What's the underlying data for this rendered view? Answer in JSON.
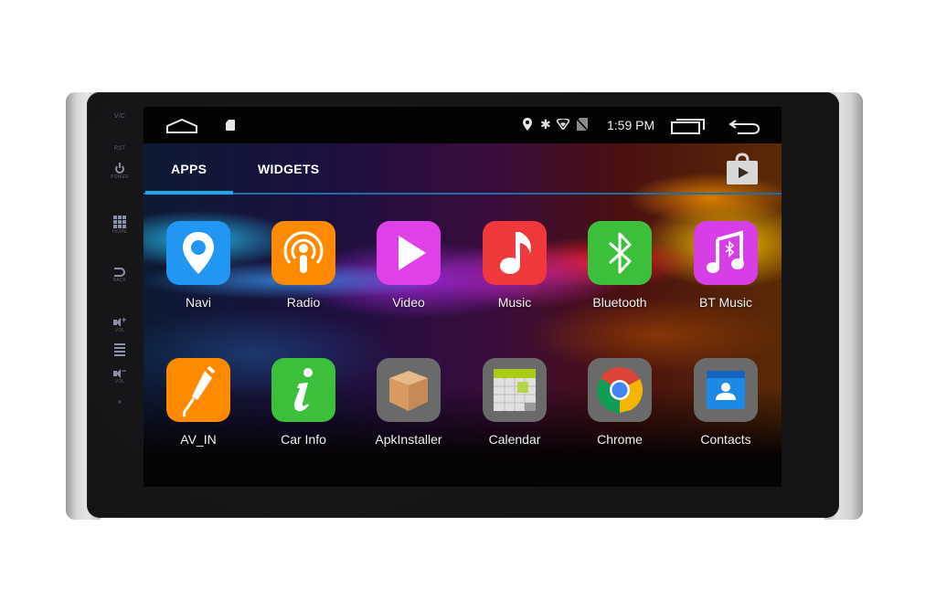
{
  "device": {
    "hardkeys": [
      {
        "id": "vc",
        "label": "V/C"
      },
      {
        "id": "rst",
        "label": "RST"
      },
      {
        "id": "power",
        "label": "POWER"
      },
      {
        "id": "home",
        "label": "HOME"
      },
      {
        "id": "back",
        "label": "BACK"
      },
      {
        "id": "volup",
        "label": "VOL"
      },
      {
        "id": "voldown",
        "label": "VOL"
      }
    ]
  },
  "statusbar": {
    "time": "1:59 PM",
    "icons": [
      "home-icon",
      "sd-card-icon",
      "location-icon",
      "bluetooth-icon",
      "wifi-icon",
      "no-sim-icon",
      "recent-apps-icon",
      "back-icon"
    ]
  },
  "tabs": [
    {
      "label": "APPS",
      "active": true
    },
    {
      "label": "WIDGETS",
      "active": false
    }
  ],
  "store_icon": "play-store-icon",
  "apps": [
    {
      "label": "Navi",
      "icon": "location-pin-icon",
      "color": "#2196f3"
    },
    {
      "label": "Radio",
      "icon": "podcast-icon",
      "color": "#ff8a00"
    },
    {
      "label": "Video",
      "icon": "play-icon",
      "color": "#e040e8"
    },
    {
      "label": "Music",
      "icon": "music-note-icon",
      "color": "#f0383c"
    },
    {
      "label": "Bluetooth",
      "icon": "bluetooth-icon",
      "color": "#3cc03c"
    },
    {
      "label": "BT Music",
      "icon": "bt-music-icon",
      "color": "#d83ee8"
    },
    {
      "label": "AV_IN",
      "icon": "av-cable-icon",
      "color": "#ff8a00"
    },
    {
      "label": "Car Info",
      "icon": "info-icon",
      "color": "#3cc03c"
    },
    {
      "label": "ApkInstaller",
      "icon": "package-box-icon",
      "color": "#6a6a6a"
    },
    {
      "label": "Calendar",
      "icon": "calendar-icon",
      "color": "#6a6a6a"
    },
    {
      "label": "Chrome",
      "icon": "chrome-icon",
      "color": "#6a6a6a"
    },
    {
      "label": "Contacts",
      "icon": "contacts-icon",
      "color": "#6a6a6a"
    }
  ],
  "colors": {
    "tab_indicator": "#1ea8e6",
    "statusbar_bg": "#030303"
  }
}
